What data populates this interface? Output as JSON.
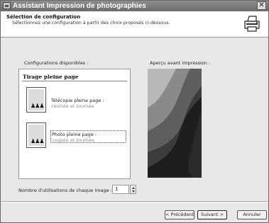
{
  "window": {
    "title": "Assistant Impression de photographies",
    "close_glyph": "✕"
  },
  "header": {
    "title": "Sélection de configuration",
    "subtitle": "Sélectionnez une configuration à partir des choix proposés ci-dessous."
  },
  "configs": {
    "label": "Configurations disponibles :",
    "group_title": "Tirage pleine page",
    "items": [
      {
        "title": "Télécopie pleine page :",
        "subtitle": "centrée et tournée"
      },
      {
        "title": "Photo pleine page :",
        "subtitle": "coupée et tournée"
      }
    ]
  },
  "preview": {
    "label": "Aperçu avant impression :"
  },
  "copies": {
    "label": "Nombre d'utilisations de chaque image :",
    "value": "1"
  },
  "buttons": {
    "back": "< Précédent",
    "next": "Suivant >",
    "cancel": "Annuler"
  }
}
